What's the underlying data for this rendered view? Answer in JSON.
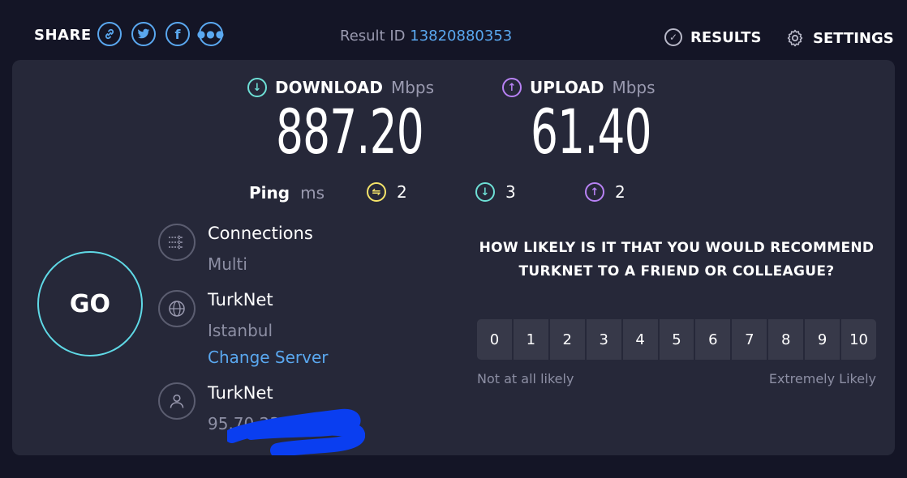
{
  "header": {
    "share_label": "SHARE",
    "share_buttons": [
      {
        "name": "link-icon"
      },
      {
        "name": "twitter-icon"
      },
      {
        "name": "facebook-icon"
      },
      {
        "name": "more-icon"
      }
    ],
    "result_id_label": "Result ID",
    "result_id_value": "13820880353",
    "results_label": "RESULTS",
    "settings_label": "SETTINGS"
  },
  "speeds": {
    "download": {
      "label": "DOWNLOAD",
      "unit": "Mbps",
      "value": "887.20"
    },
    "upload": {
      "label": "UPLOAD",
      "unit": "Mbps",
      "value": "61.40"
    }
  },
  "ping": {
    "label": "Ping",
    "unit": "ms",
    "idle": "2",
    "download": "3",
    "upload": "2"
  },
  "go_label": "GO",
  "connections": {
    "title": "Connections",
    "value": "Multi"
  },
  "server": {
    "title": "TurkNet",
    "location": "Istanbul",
    "change_label": "Change Server"
  },
  "provider": {
    "title": "TurkNet",
    "ip_partial": "95.70.233"
  },
  "survey": {
    "question": "HOW LIKELY IS IT THAT YOU WOULD RECOMMEND TURKNET TO A FRIEND OR COLLEAGUE?",
    "scale": [
      "0",
      "1",
      "2",
      "3",
      "4",
      "5",
      "6",
      "7",
      "8",
      "9",
      "10"
    ],
    "low_label": "Not at all likely",
    "high_label": "Extremely Likely"
  },
  "colors": {
    "background": "#141526",
    "panel": "#262839",
    "accent_blue": "#5aa8f0",
    "download": "#6ee0d6",
    "upload": "#b882f5",
    "jitter": "#f5e46a",
    "redaction": "#0a3ef0"
  }
}
